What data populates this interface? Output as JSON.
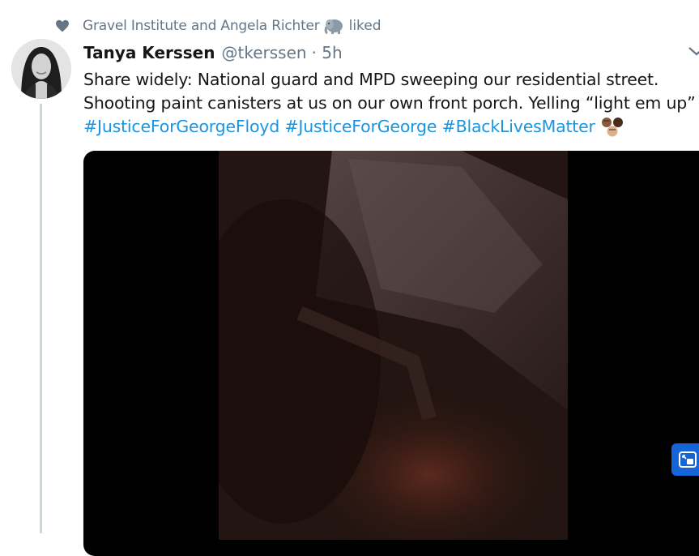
{
  "social_context": {
    "text": "Gravel Institute and Angela Richter",
    "action": "liked",
    "icon": "heart-icon",
    "emoji_icon": "elephant-icon"
  },
  "tweet": {
    "author_name": "Tanya Kerssen",
    "author_handle": "@tkerssen",
    "time": "· 5h",
    "lines": [
      "Share widely: National guard and MPD sweeping our residential street.",
      "Shooting paint canisters at us on our own front porch. Yelling “light em up”"
    ],
    "hashtags": [
      "#JusticeForGeorgeFloyd",
      "#JusticeForGeorge",
      "#BlackLivesMatter"
    ],
    "emoji": "raised-fists-icon"
  },
  "colors": {
    "link": "#1b95e0",
    "secondary_text": "#657786",
    "thread_line": "#ccd6dd",
    "pip_button": "#1565d8"
  }
}
